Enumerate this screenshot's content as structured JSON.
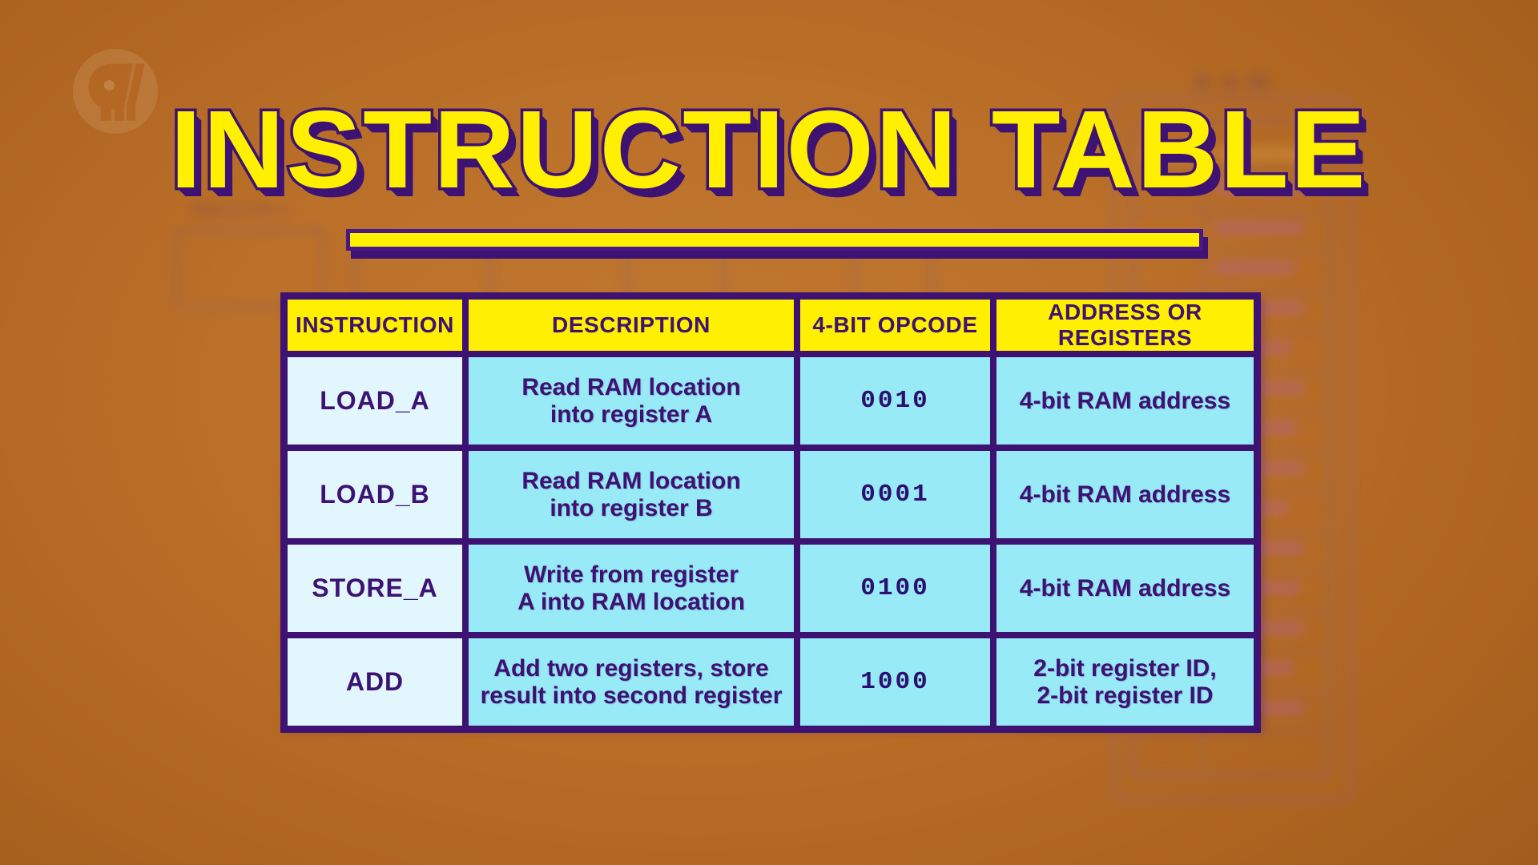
{
  "background": {
    "base_color": "#bb7029",
    "accent_yellow": "#ffef00",
    "accent_purple": "#3d1273",
    "cell_cyan": "#98eaf7",
    "cell_light_cyan": "#e2f7fd",
    "diagram_labels": {
      "register_a": "REGISTER A",
      "ram": "R.A.M.",
      "ram_col_address": "ADDRESS",
      "ram_col_data": "DATA"
    }
  },
  "logo": {
    "name": "pbs-logo",
    "icon": "pbs-head-icon"
  },
  "title": {
    "text": "INSTRUCTION TABLE"
  },
  "table": {
    "columns": [
      "INSTRUCTION",
      "DESCRIPTION",
      "4-BIT OPCODE",
      "ADDRESS OR REGISTERS"
    ],
    "rows": [
      {
        "instruction": "LOAD_A",
        "description": "Read RAM location\ninto register A",
        "opcode": "0010",
        "address": "4-bit RAM address"
      },
      {
        "instruction": "LOAD_B",
        "description": "Read RAM location\ninto register B",
        "opcode": "0001",
        "address": "4-bit RAM address"
      },
      {
        "instruction": "STORE_A",
        "description": "Write from register\nA into RAM location",
        "opcode": "0100",
        "address": "4-bit RAM address"
      },
      {
        "instruction": "ADD",
        "description": "Add two registers, store\nresult into second register",
        "opcode": "1000",
        "address": "2-bit register ID,\n2-bit register ID"
      }
    ]
  }
}
